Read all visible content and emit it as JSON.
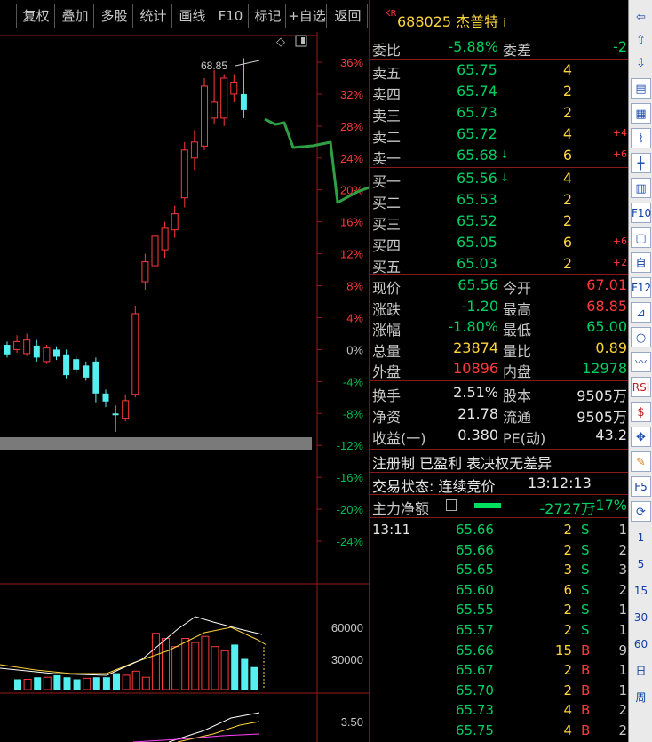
{
  "toolbar": {
    "buttons": [
      "复权",
      "叠加",
      "多股",
      "统计",
      "画线",
      "F10",
      "标记",
      "+自选",
      "返回"
    ]
  },
  "chart": {
    "high_marker": "68.85",
    "pct_ticks": [
      "36%",
      "32%",
      "28%",
      "24%",
      "20%",
      "16%",
      "12%",
      "8%",
      "4%",
      "0%",
      "-4%",
      "-8%",
      "-12%",
      "-16%",
      "-20%",
      "-24%"
    ],
    "volume_ticks": [
      "60000",
      "30000"
    ],
    "indicator_tick": "3.50"
  },
  "header": {
    "market_tag": "KR",
    "code_name": "688025 杰普特",
    "info_icon": "i"
  },
  "committee": {
    "ratio_label": "委比",
    "ratio_value": "-5.88%",
    "diff_label": "委差",
    "diff_value": "-2"
  },
  "asks": [
    {
      "label": "卖五",
      "price": "65.75",
      "vol": "4",
      "chg": ""
    },
    {
      "label": "卖四",
      "price": "65.74",
      "vol": "2",
      "chg": ""
    },
    {
      "label": "卖三",
      "price": "65.73",
      "vol": "2",
      "chg": ""
    },
    {
      "label": "卖二",
      "price": "65.72",
      "vol": "4",
      "chg": "+4"
    },
    {
      "label": "卖一",
      "price": "65.68",
      "vol": "6",
      "chg": "+6"
    }
  ],
  "bids": [
    {
      "label": "买一",
      "price": "65.56",
      "vol": "4",
      "chg": ""
    },
    {
      "label": "买二",
      "price": "65.53",
      "vol": "2",
      "chg": ""
    },
    {
      "label": "买三",
      "price": "65.52",
      "vol": "2",
      "chg": ""
    },
    {
      "label": "买四",
      "price": "65.05",
      "vol": "6",
      "chg": "+6"
    },
    {
      "label": "买五",
      "price": "65.03",
      "vol": "2",
      "chg": "+2"
    }
  ],
  "quote": [
    {
      "l1": "现价",
      "v1": "65.56",
      "c1": "dn",
      "l2": "今开",
      "v2": "67.01",
      "c2": "up"
    },
    {
      "l1": "涨跌",
      "v1": "-1.20",
      "c1": "dn",
      "l2": "最高",
      "v2": "68.85",
      "c2": "up"
    },
    {
      "l1": "涨幅",
      "v1": "-1.80%",
      "c1": "dn",
      "l2": "最低",
      "v2": "65.00",
      "c2": "dn"
    },
    {
      "l1": "总量",
      "v1": "23874",
      "c1": "yl",
      "l2": "量比",
      "v2": "0.89",
      "c2": "yl"
    },
    {
      "l1": "外盘",
      "v1": "10896",
      "c1": "up",
      "l2": "内盘",
      "v2": "12978",
      "c2": "dn"
    }
  ],
  "stats": [
    {
      "l1": "换手",
      "v1": "2.51%",
      "l2": "股本",
      "v2": "9505万"
    },
    {
      "l1": "净资",
      "v1": "21.78",
      "l2": "流通",
      "v2": "9505万"
    },
    {
      "l1": "收益(一)",
      "v1": "0.380",
      "l2": "PE(动)",
      "v2": "43.2"
    }
  ],
  "notes": {
    "tags": "注册制 已盈利 表决权无差异",
    "status_label": "交易状态: 连续竞价",
    "status_time": "13:12:13",
    "main_force_label": "主力净额",
    "main_force_value": "-2727万",
    "main_force_pct": "-17%"
  },
  "trades": [
    {
      "time": "13:11",
      "price": "65.66",
      "vol": "2",
      "side": "S",
      "cnt": "1"
    },
    {
      "time": "",
      "price": "65.66",
      "vol": "2",
      "side": "S",
      "cnt": "2"
    },
    {
      "time": "",
      "price": "65.65",
      "vol": "3",
      "side": "S",
      "cnt": "3"
    },
    {
      "time": "",
      "price": "65.60",
      "vol": "6",
      "side": "S",
      "cnt": "2"
    },
    {
      "time": "",
      "price": "65.55",
      "vol": "2",
      "side": "S",
      "cnt": "1"
    },
    {
      "time": "",
      "price": "65.57",
      "vol": "2",
      "side": "S",
      "cnt": "1"
    },
    {
      "time": "",
      "price": "65.66",
      "vol": "15",
      "side": "B",
      "cnt": "9"
    },
    {
      "time": "",
      "price": "65.67",
      "vol": "2",
      "side": "B",
      "cnt": "1"
    },
    {
      "time": "",
      "price": "65.70",
      "vol": "2",
      "side": "B",
      "cnt": "1"
    },
    {
      "time": "",
      "price": "65.73",
      "vol": "4",
      "side": "B",
      "cnt": "2"
    },
    {
      "time": "",
      "price": "65.75",
      "vol": "4",
      "side": "B",
      "cnt": "2"
    }
  ],
  "sidebar": {
    "items": [
      "left-arrow-icon",
      "up-arrow-icon",
      "down-arrow-icon",
      "stock-list-icon",
      "grid-icon",
      "line-chart-icon",
      "candle-icon",
      "table-icon",
      "F10",
      "news-icon",
      "自",
      "F12",
      "分析-icon",
      "circle-icon",
      "trend-icon",
      "RSI",
      "dollar-icon",
      "move-icon",
      "pencil-icon",
      "F5",
      "refresh-icon",
      "1",
      "5",
      "15",
      "30",
      "60",
      "日",
      "周"
    ]
  },
  "chart_data": {
    "type": "candlestick",
    "y_axis_ticks_pct": [
      "36%",
      "32%",
      "28%",
      "24%",
      "20%",
      "16%",
      "12%",
      "8%",
      "4%",
      "0%",
      "-4%",
      "-8%",
      "-12%",
      "-16%",
      "-20%",
      "-24%"
    ],
    "high_label": "68.85",
    "candles_pct": [
      {
        "o": 0.6,
        "c": -0.6,
        "h": 1.0,
        "l": -1.0
      },
      {
        "o": 0.0,
        "c": 1.0,
        "h": 1.8,
        "l": -0.4
      },
      {
        "o": -0.5,
        "c": 1.2,
        "h": 2.0,
        "l": -0.8
      },
      {
        "o": 0.5,
        "c": -1.0,
        "h": 1.2,
        "l": -1.5
      },
      {
        "o": -1.5,
        "c": 0.2,
        "h": 0.6,
        "l": -1.8
      },
      {
        "o": 0.0,
        "c": -0.9,
        "h": 0.4,
        "l": -1.3
      },
      {
        "o": -0.6,
        "c": -3.2,
        "h": 0.0,
        "l": -3.6
      },
      {
        "o": -1.2,
        "c": -2.5,
        "h": -0.8,
        "l": -3.0
      },
      {
        "o": -2.0,
        "c": -3.5,
        "h": -1.5,
        "l": -3.9
      },
      {
        "o": -1.5,
        "c": -5.5,
        "h": -1.0,
        "l": -6.6
      },
      {
        "o": -5.5,
        "c": -6.5,
        "h": -5.0,
        "l": -7.2
      },
      {
        "o": -8.0,
        "c": -8.2,
        "h": -7.0,
        "l": -10.3
      },
      {
        "o": -8.6,
        "c": -6.4,
        "h": -5.6,
        "l": -9.0
      },
      {
        "o": -5.6,
        "c": 4.5,
        "h": 5.5,
        "l": -6.0
      },
      {
        "o": 8.5,
        "c": 11.0,
        "h": 12.0,
        "l": 7.5
      },
      {
        "o": 10.5,
        "c": 14.2,
        "h": 15.5,
        "l": 9.8
      },
      {
        "o": 12.5,
        "c": 15.2,
        "h": 16.0,
        "l": 11.5
      },
      {
        "o": 15.0,
        "c": 17.0,
        "h": 18.0,
        "l": 14.0
      },
      {
        "o": 19.0,
        "c": 25.0,
        "h": 26.0,
        "l": 17.8
      },
      {
        "o": 24.0,
        "c": 26.0,
        "h": 27.5,
        "l": 22.5
      },
      {
        "o": 25.5,
        "c": 33.0,
        "h": 34.0,
        "l": 25.0
      },
      {
        "o": 29.0,
        "c": 31.0,
        "h": 35.0,
        "l": 28.2
      },
      {
        "o": 29.0,
        "c": 34.0,
        "h": 34.5,
        "l": 28.0
      },
      {
        "o": 32.0,
        "c": 33.5,
        "h": 34.5,
        "l": 31.0
      },
      {
        "o": 32.0,
        "c": 30.0,
        "h": 36.5,
        "l": 29.0
      }
    ],
    "volume_ticks": [
      "60000",
      "30000"
    ],
    "indicator_tick": "3.50"
  }
}
